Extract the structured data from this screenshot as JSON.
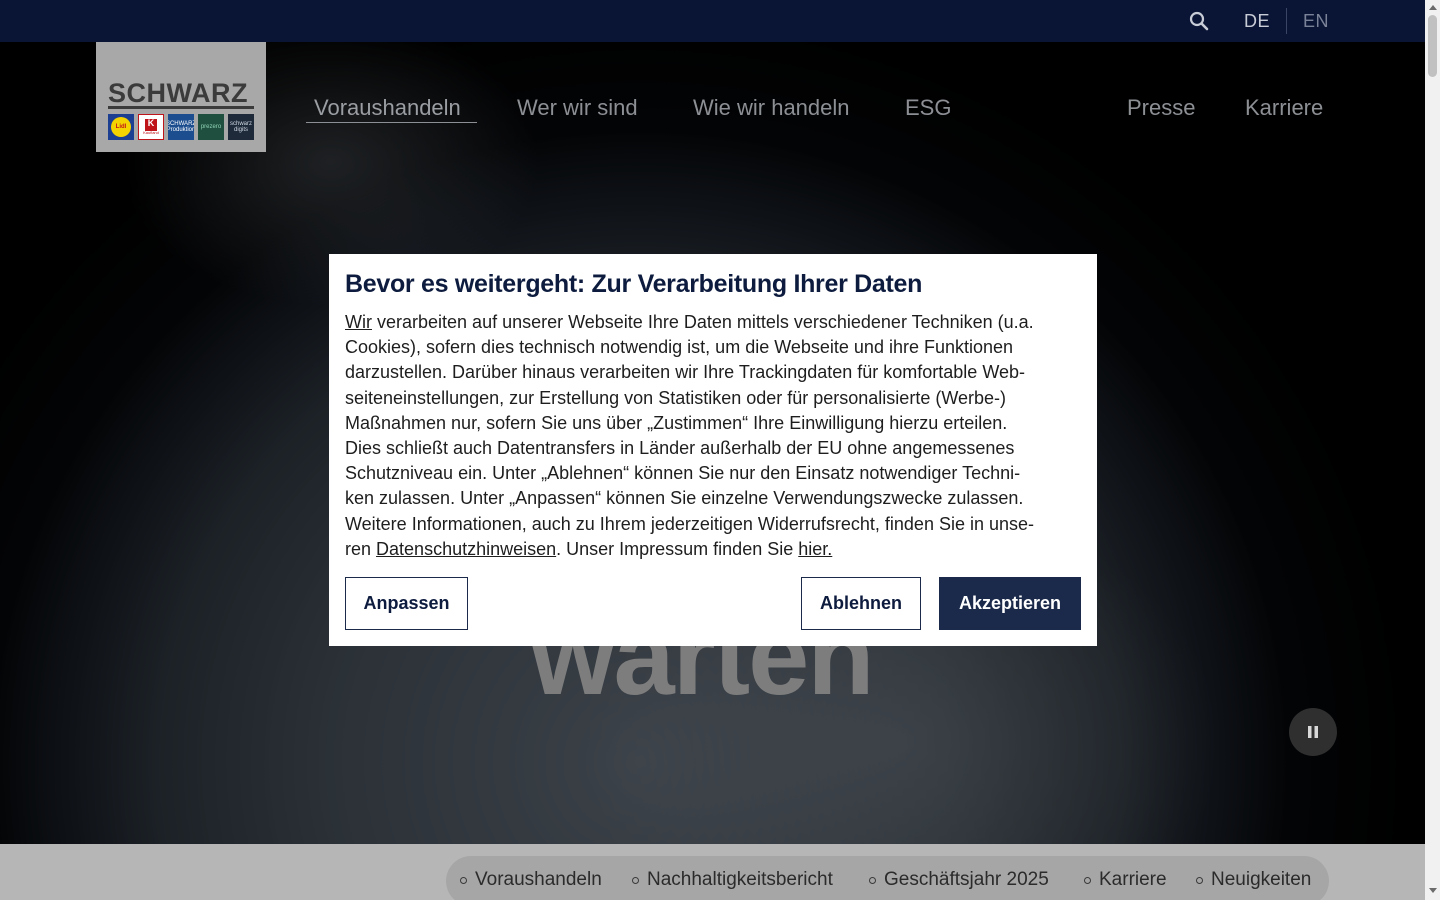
{
  "topbar": {
    "search_icon": "search-icon",
    "languages": [
      "DE",
      "EN"
    ],
    "active_language": "DE"
  },
  "logo": {
    "wordmark": "SCHWARZ",
    "brands": [
      "Lidl",
      "Kaufland",
      "SCHWARZ Produktion",
      "prezero",
      "schwarz digits"
    ]
  },
  "nav": {
    "items": [
      "Voraushandeln",
      "Wer wir sind",
      "Wie wir handeln",
      "ESG",
      "Presse",
      "Karriere"
    ],
    "active": "Voraushandeln"
  },
  "hero": {
    "headline_fragment": "warten",
    "pause_icon": "pause-icon"
  },
  "consent": {
    "title": "Bevor es weitergeht: Zur Verarbeitung Ihrer Daten",
    "body_lines": [
      "verarbeiten auf unserer Webseite Ihre Daten mittels verschiedener Techniken (u.a.",
      "Cookies), sofern dies technisch notwendig ist, um die Webseite und ihre Funktionen",
      "darzustellen. Darüber hinaus verarbeiten wir Ihre Trackingdaten für komfortable Web-",
      "seiteneinstellungen, zur Erstellung von Statistiken oder für personalisierte (Werbe-)",
      "Maßnahmen nur, sofern Sie uns über „Zustimmen“ Ihre Einwilligung hierzu erteilen.",
      "Dies schließt auch Datentransfers in Länder außerhalb der EU ohne angemessenes",
      "Schutzniveau ein. Unter „Ablehnen“ können Sie nur den Einsatz notwendiger Techni-",
      "ken zulassen. Unter „Anpassen“ können Sie einzelne Verwendungszwecke zulassen.",
      "Weitere Informationen, auch zu Ihrem jederzeitigen Widerrufsrecht, finden Sie in unse-"
    ],
    "link_wir": "Wir",
    "last_line_prefix": "ren ",
    "link_privacy": "Datenschutzhinweisen",
    "last_line_middle": ". Unser Impressum finden Sie ",
    "link_imprint": "hier.",
    "buttons": {
      "customize": "Anpassen",
      "reject": "Ablehnen",
      "accept": "Akzeptieren"
    }
  },
  "bottom_nav": {
    "items": [
      "Voraushandeln",
      "Nachhaltigkeitsbericht",
      "Geschäftsjahr 2025",
      "Karriere",
      "Neuigkeiten"
    ]
  },
  "colors": {
    "topbar": "#0a1535",
    "accent_button": "#1b2a4a",
    "title_text": "#0d1b3e"
  }
}
